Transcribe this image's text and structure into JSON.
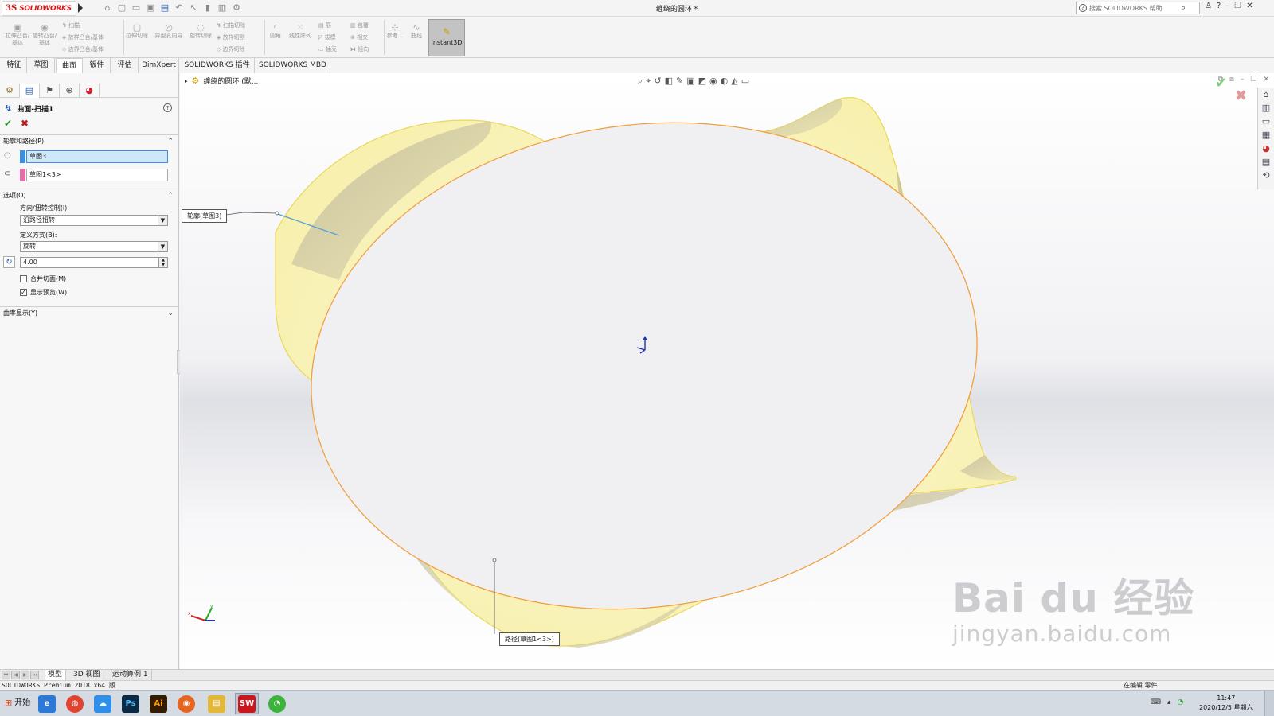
{
  "app": {
    "logo_prefix": "3S",
    "logo_name": "SOLIDWORKS",
    "document_title": "缠绕的圆环 *",
    "search_placeholder": "搜索 SOLIDWORKS 帮助"
  },
  "quick_access": {
    "icons": [
      "home-icon",
      "new-icon",
      "open-icon",
      "save-icon",
      "print-icon",
      "undo-icon",
      "select-icon",
      "rebuild-icon",
      "file-properties-icon",
      "options-icon"
    ]
  },
  "ribbon": {
    "items": [
      {
        "label": "拉伸凸台/基体",
        "glyph": "▣"
      },
      {
        "label": "旋转凸台/基体",
        "glyph": "◉"
      },
      {
        "label": "扫描",
        "glyph": "↯"
      },
      {
        "label": "放样凸台/基体",
        "glyph": "◈"
      },
      {
        "label": "边界凸台/基体",
        "glyph": "◇"
      },
      {
        "label": "拉伸切除",
        "glyph": "▢"
      },
      {
        "label": "异型孔向导",
        "glyph": "◎"
      },
      {
        "label": "旋转切除",
        "glyph": "◌"
      },
      {
        "label": "扫描切除",
        "glyph": "↯"
      },
      {
        "label": "放样切割",
        "glyph": "◈"
      },
      {
        "label": "边界切除",
        "glyph": "◇"
      },
      {
        "label": "圆角",
        "glyph": "◜"
      },
      {
        "label": "线性阵列",
        "glyph": "⁙"
      },
      {
        "label": "筋",
        "glyph": "▤"
      },
      {
        "label": "拔模",
        "glyph": "◸"
      },
      {
        "label": "抽壳",
        "glyph": "▭"
      },
      {
        "label": "包覆",
        "glyph": "▥"
      },
      {
        "label": "相交",
        "glyph": "⊗"
      },
      {
        "label": "镜向",
        "glyph": "⧓"
      },
      {
        "label": "参考...",
        "glyph": "⊹"
      },
      {
        "label": "曲线",
        "glyph": "∿"
      },
      {
        "label": "Instant3D",
        "glyph": "✎"
      }
    ]
  },
  "tabs": [
    "特征",
    "草图",
    "曲面",
    "钣件",
    "评估",
    "DimXpert",
    "SOLIDWORKS 插件",
    "SOLIDWORKS MBD"
  ],
  "active_tab": "曲面",
  "property_manager": {
    "title": "曲面-扫描1",
    "help": "?",
    "ok_glyph": "✔",
    "cancel_glyph": "✖",
    "section_profile_path": "轮廓和路径(P)",
    "profile_value": "草图3",
    "path_value": "草图1<3>",
    "section_options": "选项(O)",
    "orientation_label": "方向/扭转控制(I):",
    "orientation_value": "沿路径扭转",
    "define_by_label": "定义方式(B):",
    "define_by_value": "旋转",
    "twist_value": "4.00",
    "merge_tangent_label": "合并切面(M)",
    "merge_tangent_checked": false,
    "show_preview_label": "显示预览(W)",
    "show_preview_checked": true,
    "section_curvature": "曲率显示(Y)"
  },
  "viewport": {
    "breadcrumb": "缠绕的圆环  (默...",
    "profile_callout": "轮廓(草图3)",
    "path_callout": "路径(草图1<3>)"
  },
  "bottom_tabs": [
    "模型",
    "3D 视图",
    "运动算例 1"
  ],
  "active_bottom_tab": "模型",
  "status": {
    "left": "SOLIDWORKS Premium 2018 x64 版",
    "editing": "在编辑  零件"
  },
  "taskbar": {
    "start_label": "开始",
    "apps": [
      {
        "name": "browser-app",
        "text": "e",
        "color": "#2d7ad6"
      },
      {
        "name": "chrome-app",
        "text": "◍",
        "color": "#e0432f"
      },
      {
        "name": "baidu-netdisk-app",
        "text": "☁",
        "color": "#2f8ee8"
      },
      {
        "name": "photoshop-app",
        "text": "Ps",
        "color": "#0a2a44"
      },
      {
        "name": "illustrator-app",
        "text": "Ai",
        "color": "#331c00"
      },
      {
        "name": "firefox-app",
        "text": "◉",
        "color": "#e66320"
      },
      {
        "name": "explorer-app",
        "text": "▤",
        "color": "#e2b73a"
      },
      {
        "name": "solidworks-app",
        "text": "SW",
        "color": "#c9181d"
      },
      {
        "name": "wechat-app",
        "text": "◔",
        "color": "#3bb33b"
      }
    ],
    "time": "11:47",
    "date": "2020/12/5 星期六"
  },
  "watermark": {
    "brand": "Bai du 经验",
    "url": "jingyan.baidu.com"
  },
  "colors": {
    "accent_selection": "#cde8fb",
    "profile_swatch": "#3d8ee0",
    "path_swatch": "#e46fa7",
    "surface_fill": "#fdf7c2",
    "path_edge": "#f0a040"
  }
}
